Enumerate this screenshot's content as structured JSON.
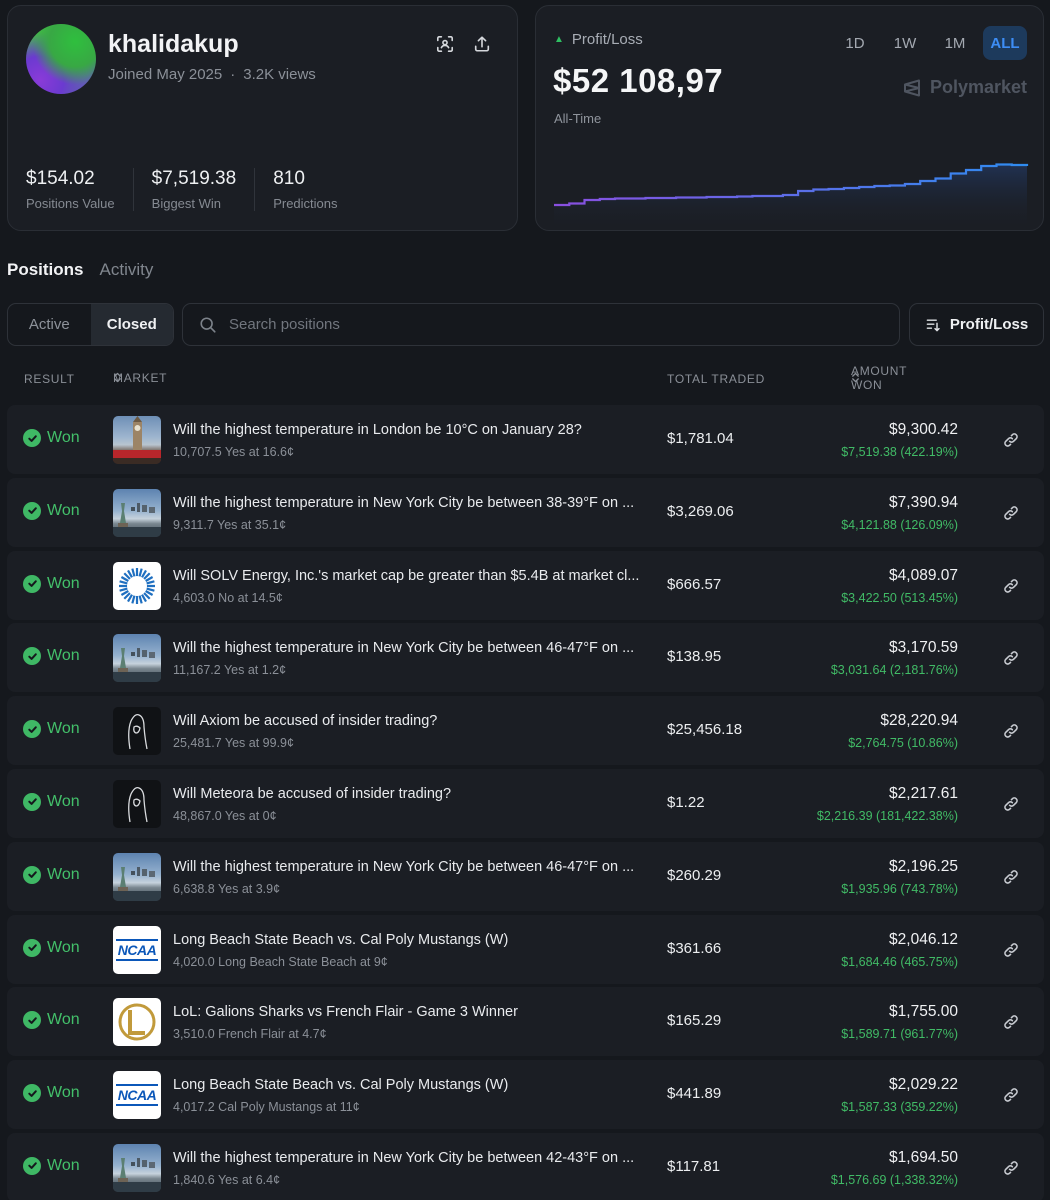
{
  "profile": {
    "username": "khalidakup",
    "joined": "Joined May 2025",
    "views": "3.2K views",
    "stats": [
      {
        "value": "$154.02",
        "label": "Positions Value"
      },
      {
        "value": "$7,519.38",
        "label": "Biggest Win"
      },
      {
        "value": "810",
        "label": "Predictions"
      }
    ]
  },
  "pnl": {
    "title": "Profit/Loss",
    "value": "$52 108,97",
    "period": "All-Time",
    "ranges": [
      "1D",
      "1W",
      "1M",
      "ALL"
    ],
    "active_range": "ALL",
    "brand": "Polymarket",
    "accent": "#3d8df5",
    "series": [
      0.02,
      0.05,
      0.12,
      0.14,
      0.15,
      0.15,
      0.16,
      0.16,
      0.17,
      0.17,
      0.18,
      0.18,
      0.19,
      0.2,
      0.2,
      0.22,
      0.3,
      0.33,
      0.34,
      0.36,
      0.38,
      0.4,
      0.41,
      0.44,
      0.5,
      0.55,
      0.65,
      0.72,
      0.8,
      0.83,
      0.82,
      0.8
    ]
  },
  "tabs": {
    "positions": "Positions",
    "activity": "Activity"
  },
  "filters": {
    "active": "Active",
    "closed": "Closed",
    "search_placeholder": "Search positions",
    "sort_label": "Profit/Loss"
  },
  "table": {
    "headers": {
      "result": "RESULT",
      "market": "MARKET",
      "total_traded": "TOTAL TRADED",
      "amount_won": "AMOUNT WON"
    },
    "rows": [
      {
        "result": "Won",
        "thumb": "london",
        "title": "Will the highest temperature in London be 10°C on January 28?",
        "sub": "10,707.5 Yes at 16.6¢",
        "traded": "$1,781.04",
        "amount": "$9,300.42",
        "profit": "$7,519.38 (422.19%)"
      },
      {
        "result": "Won",
        "thumb": "nyc",
        "title": "Will the highest temperature in New York City be between 38-39°F on ...",
        "sub": "9,311.7 Yes at 35.1¢",
        "traded": "$3,269.06",
        "amount": "$7,390.94",
        "profit": "$4,121.88 (126.09%)"
      },
      {
        "result": "Won",
        "thumb": "solv",
        "title": "Will SOLV Energy, Inc.'s market cap be greater than $5.4B at market cl...",
        "sub": "4,603.0 No at 14.5¢",
        "traded": "$666.57",
        "amount": "$4,089.07",
        "profit": "$3,422.50 (513.45%)"
      },
      {
        "result": "Won",
        "thumb": "nyc",
        "title": "Will the highest temperature in New York City be between 46-47°F on ...",
        "sub": "11,167.2 Yes at 1.2¢",
        "traded": "$138.95",
        "amount": "$3,170.59",
        "profit": "$3,031.64 (2,181.76%)"
      },
      {
        "result": "Won",
        "thumb": "dark",
        "title": "Will Axiom be accused of insider trading?",
        "sub": "25,481.7 Yes at 99.9¢",
        "traded": "$25,456.18",
        "amount": "$28,220.94",
        "profit": "$2,764.75 (10.86%)"
      },
      {
        "result": "Won",
        "thumb": "dark",
        "title": "Will Meteora be accused of insider trading?",
        "sub": "48,867.0 Yes at 0¢",
        "traded": "$1.22",
        "amount": "$2,217.61",
        "profit": "$2,216.39 (181,422.38%)"
      },
      {
        "result": "Won",
        "thumb": "nyc",
        "title": "Will the highest temperature in New York City be between 46-47°F on ...",
        "sub": "6,638.8 Yes at 3.9¢",
        "traded": "$260.29",
        "amount": "$2,196.25",
        "profit": "$1,935.96 (743.78%)"
      },
      {
        "result": "Won",
        "thumb": "ncaa",
        "title": "Long Beach State Beach vs. Cal Poly Mustangs (W)",
        "sub": "4,020.0 Long Beach State Beach at 9¢",
        "traded": "$361.66",
        "amount": "$2,046.12",
        "profit": "$1,684.46 (465.75%)"
      },
      {
        "result": "Won",
        "thumb": "lol",
        "title": "LoL: Galions Sharks vs French Flair - Game 3 Winner",
        "sub": "3,510.0 French Flair at 4.7¢",
        "traded": "$165.29",
        "amount": "$1,755.00",
        "profit": "$1,589.71 (961.77%)"
      },
      {
        "result": "Won",
        "thumb": "ncaa",
        "title": "Long Beach State Beach vs. Cal Poly Mustangs (W)",
        "sub": "4,017.2 Cal Poly Mustangs at 11¢",
        "traded": "$441.89",
        "amount": "$2,029.22",
        "profit": "$1,587.33 (359.22%)"
      },
      {
        "result": "Won",
        "thumb": "nyc",
        "title": "Will the highest temperature in New York City be between 42-43°F on ...",
        "sub": "1,840.6 Yes at 6.4¢",
        "traded": "$117.81",
        "amount": "$1,694.50",
        "profit": "$1,576.69 (1,338.32%)"
      }
    ],
    "ncaa_logo_text": "NCAA"
  }
}
